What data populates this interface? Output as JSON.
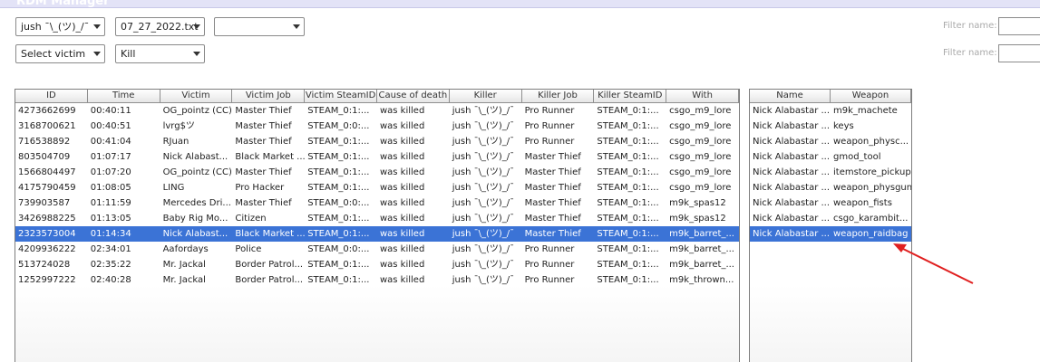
{
  "window": {
    "title": "RDM Manager"
  },
  "filters": {
    "player": "jush ¯\\_(ツ)_/¯",
    "date_file": "07_27_2022.txt",
    "third": "",
    "victim": "Select victim",
    "type": "Kill"
  },
  "filter_name_label_1": "Filter name:",
  "filter_name_label_2": "Filter name:",
  "main_table": {
    "columns": [
      "ID",
      "Time",
      "Victim",
      "Victim Job",
      "Victim SteamID",
      "Cause of death",
      "Killer",
      "Killer Job",
      "Killer SteamID",
      "With"
    ],
    "rows": [
      [
        "4273662699",
        "00:40:11",
        "OG_pointz (CC)",
        "Master Thief",
        "STEAM_0:1:...",
        "was killed",
        "jush ¯\\_(ツ)_/¯",
        "Pro Runner",
        "STEAM_0:1:...",
        "csgo_m9_lore"
      ],
      [
        "3168700621",
        "00:40:51",
        "lvrg$ツ",
        "Master Thief",
        "STEAM_0:0:...",
        "was killed",
        "jush ¯\\_(ツ)_/¯",
        "Pro Runner",
        "STEAM_0:1:...",
        "csgo_m9_lore"
      ],
      [
        "716538892",
        "00:41:04",
        "RJuan",
        "Master Thief",
        "STEAM_0:1:...",
        "was killed",
        "jush ¯\\_(ツ)_/¯",
        "Pro Runner",
        "STEAM_0:1:...",
        "csgo_m9_lore"
      ],
      [
        "803504709",
        "01:07:17",
        "Nick Alabast...",
        "Black Market ...",
        "STEAM_0:1:...",
        "was killed",
        "jush ¯\\_(ツ)_/¯",
        "Master Thief",
        "STEAM_0:1:...",
        "csgo_m9_lore"
      ],
      [
        "1566804497",
        "01:07:20",
        "OG_pointz (CC)",
        "Master Thief",
        "STEAM_0:1:...",
        "was killed",
        "jush ¯\\_(ツ)_/¯",
        "Master Thief",
        "STEAM_0:1:...",
        "csgo_m9_lore"
      ],
      [
        "4175790459",
        "01:08:05",
        "LING",
        "Pro Hacker",
        "STEAM_0:1:...",
        "was killed",
        "jush ¯\\_(ツ)_/¯",
        "Master Thief",
        "STEAM_0:1:...",
        "csgo_m9_lore"
      ],
      [
        "739903587",
        "01:11:59",
        "Mercedes Dri...",
        "Master Thief",
        "STEAM_0:0:...",
        "was killed",
        "jush ¯\\_(ツ)_/¯",
        "Master Thief",
        "STEAM_0:1:...",
        "m9k_spas12"
      ],
      [
        "3426988225",
        "01:13:05",
        "Baby Rig Mo...",
        "Citizen",
        "STEAM_0:1:...",
        "was killed",
        "jush ¯\\_(ツ)_/¯",
        "Master Thief",
        "STEAM_0:1:...",
        "m9k_spas12"
      ],
      [
        "2323573004",
        "01:14:34",
        "Nick Alabast...",
        "Black Market ...",
        "STEAM_0:1:...",
        "was killed",
        "jush ¯\\_(ツ)_/¯",
        "Master Thief",
        "STEAM_0:1:...",
        "m9k_barret_..."
      ],
      [
        "4209936222",
        "02:34:01",
        "Aafordays",
        "Police",
        "STEAM_0:0:...",
        "was killed",
        "jush ¯\\_(ツ)_/¯",
        "Pro Runner",
        "STEAM_0:1:...",
        "m9k_barret_..."
      ],
      [
        "513724028",
        "02:35:22",
        "Mr. Jackal",
        "Border Patrol...",
        "STEAM_0:1:...",
        "was killed",
        "jush ¯\\_(ツ)_/¯",
        "Pro Runner",
        "STEAM_0:1:...",
        "m9k_barret_..."
      ],
      [
        "1252997222",
        "02:40:28",
        "Mr. Jackal",
        "Border Patrol...",
        "STEAM_0:1:...",
        "was killed",
        "jush ¯\\_(ツ)_/¯",
        "Pro Runner",
        "STEAM_0:1:...",
        "m9k_thrown..."
      ]
    ],
    "selected_row": 8
  },
  "inventory_table": {
    "columns": [
      "Name",
      "Weapon"
    ],
    "rows": [
      [
        "Nick Alabastar ...",
        "m9k_machete"
      ],
      [
        "Nick Alabastar ...",
        "keys"
      ],
      [
        "Nick Alabastar ...",
        "weapon_physc..."
      ],
      [
        "Nick Alabastar ...",
        "gmod_tool"
      ],
      [
        "Nick Alabastar ...",
        "itemstore_pickup"
      ],
      [
        "Nick Alabastar ...",
        "weapon_physgun"
      ],
      [
        "Nick Alabastar ...",
        "weapon_fists"
      ],
      [
        "Nick Alabastar ...",
        "csgo_karambit..."
      ],
      [
        "Nick Alabastar ...",
        "weapon_raidbag"
      ]
    ],
    "selected_row": 8
  },
  "colors": {
    "selection": "#3b73d6",
    "annotation_arrow": "#e02020"
  }
}
